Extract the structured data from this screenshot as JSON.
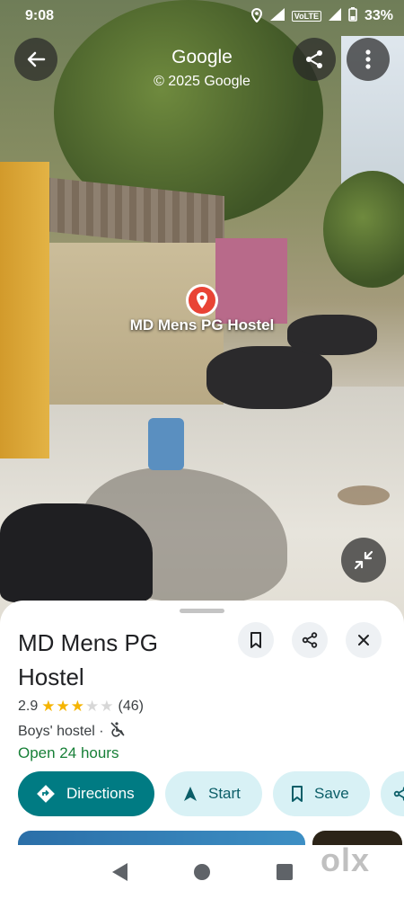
{
  "status_bar": {
    "time": "9:08",
    "network": "VoLTE",
    "battery": "33%"
  },
  "header": {
    "title": "Google",
    "copyright": "© 2025 Google"
  },
  "marker": {
    "label": "MD Mens PG Hostel"
  },
  "place": {
    "name": "MD Mens PG Hostel",
    "rating": "2.9",
    "stars_filled": 3,
    "stars_total": 5,
    "review_count": "(46)",
    "category": "Boys' hostel ·",
    "hours": "Open 24 hours"
  },
  "actions": {
    "directions": "Directions",
    "start": "Start",
    "save": "Save"
  },
  "watermark": "olx",
  "colors": {
    "accent": "#007b83",
    "open": "#188038",
    "marker": "#e94335",
    "star": "#f5b400"
  }
}
